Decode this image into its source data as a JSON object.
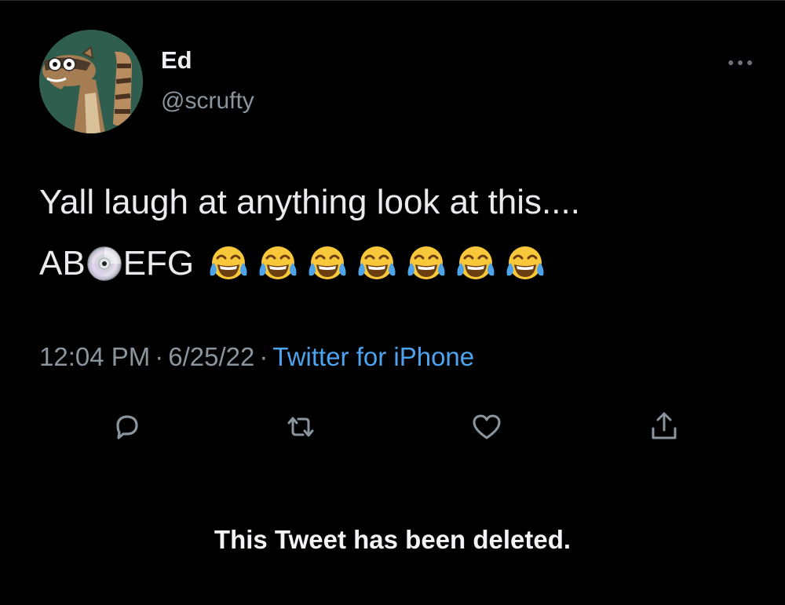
{
  "tweet": {
    "author": {
      "display_name": "Ed",
      "handle": "@scrufty",
      "avatar_icon": "raccoon-avatar"
    },
    "text_line1": "Yall laugh at anything look at this....",
    "text_line2_prefix": "AB",
    "text_line2_icon": "cd-disc-icon",
    "text_line2_suffix": "EFG",
    "emojis": [
      "😂",
      "😂",
      "😂",
      "😂",
      "😂",
      "😂",
      "😂"
    ],
    "timestamp": "12:04 PM",
    "date": "6/25/22",
    "separator": "·",
    "source": "Twitter for iPhone"
  },
  "actions": {
    "icons": [
      "reply-icon",
      "retweet-icon",
      "like-icon",
      "share-icon"
    ]
  },
  "notice": {
    "text": "This Tweet has been deleted."
  },
  "colors": {
    "background": "#000000",
    "text": "#e7e9ea",
    "muted": "#8b959e",
    "link": "#4da3ee"
  }
}
